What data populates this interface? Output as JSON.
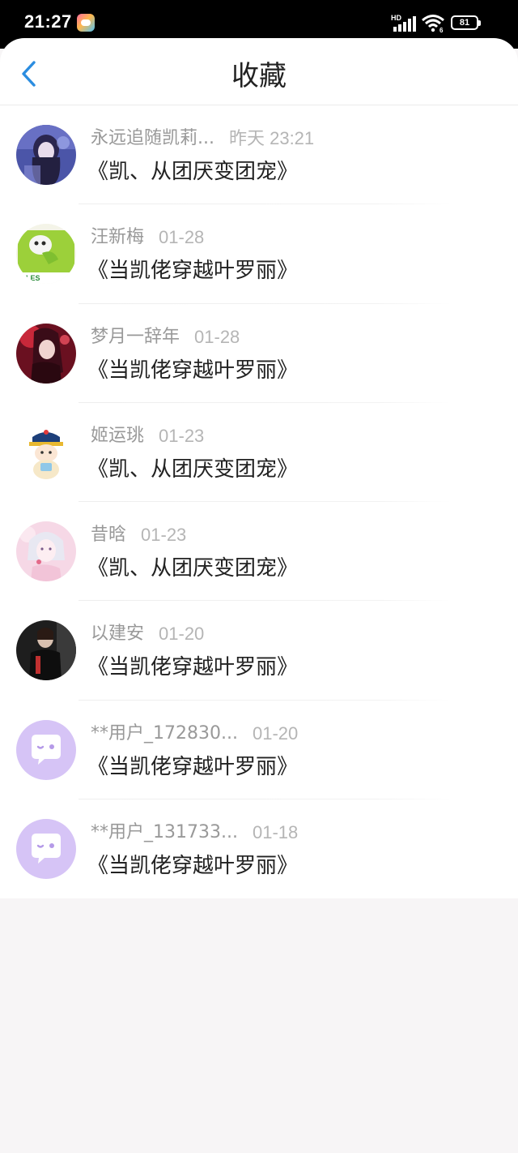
{
  "status_bar": {
    "time": "21:27",
    "hd": "HD",
    "battery": "81"
  },
  "header": {
    "title": "收藏"
  },
  "favorites": [
    {
      "user": "永远追随凯莉...",
      "date": "昨天 23:21",
      "book": "《凯、从团厌变团宠》",
      "avatar": "dark-anime-girl"
    },
    {
      "user": "汪新梅",
      "date": "01-28",
      "book": "《当凯佬穿越叶罗丽》",
      "avatar": "green-cartoon"
    },
    {
      "user": "梦月一辞年",
      "date": "01-28",
      "book": "《当凯佬穿越叶罗丽》",
      "avatar": "red-anime-girl"
    },
    {
      "user": "姬运珧",
      "date": "01-23",
      "book": "《凯、从团厌变团宠》",
      "avatar": "cartoon-child"
    },
    {
      "user": "昔晗",
      "date": "01-23",
      "book": "《凯、从团厌变团宠》",
      "avatar": "pink-anime-girl"
    },
    {
      "user": "以建安",
      "date": "01-20",
      "book": "《当凯佬穿越叶罗丽》",
      "avatar": "dark-photo"
    },
    {
      "user": "**用户_172830...",
      "date": "01-20",
      "book": "《当凯佬穿越叶罗丽》",
      "avatar": "default-chat"
    },
    {
      "user": "**用户_131733...",
      "date": "01-18",
      "book": "《当凯佬穿越叶罗丽》",
      "avatar": "default-chat"
    }
  ],
  "colors": {
    "accent": "#2b8de0",
    "default_avatar": "#d6c4f6",
    "background": "#f7f5f6"
  }
}
